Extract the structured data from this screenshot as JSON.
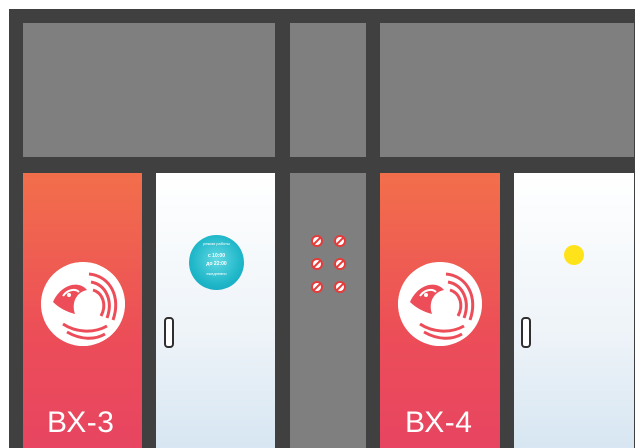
{
  "doors": [
    {
      "label": "ВХ-3"
    },
    {
      "label": "ВХ-4"
    }
  ],
  "badge": {
    "title": "режим работы",
    "line1": "с 10:00",
    "line2": "до 22:00",
    "note": "ежедневно"
  },
  "colors": {
    "frame": "#404040",
    "transom": "#7f7f7f",
    "door_gradient_top": "#f26f4b",
    "door_gradient_bottom": "#e74561",
    "badge": "#1fb7c9",
    "dot": "#ffe31a"
  },
  "icons": [
    "no-entry-sign-icon",
    "no-smoking-sign-icon",
    "no-pets-sign-icon",
    "no-food-sign-icon",
    "no-scooter-sign-icon",
    "no-drinks-sign-icon"
  ]
}
